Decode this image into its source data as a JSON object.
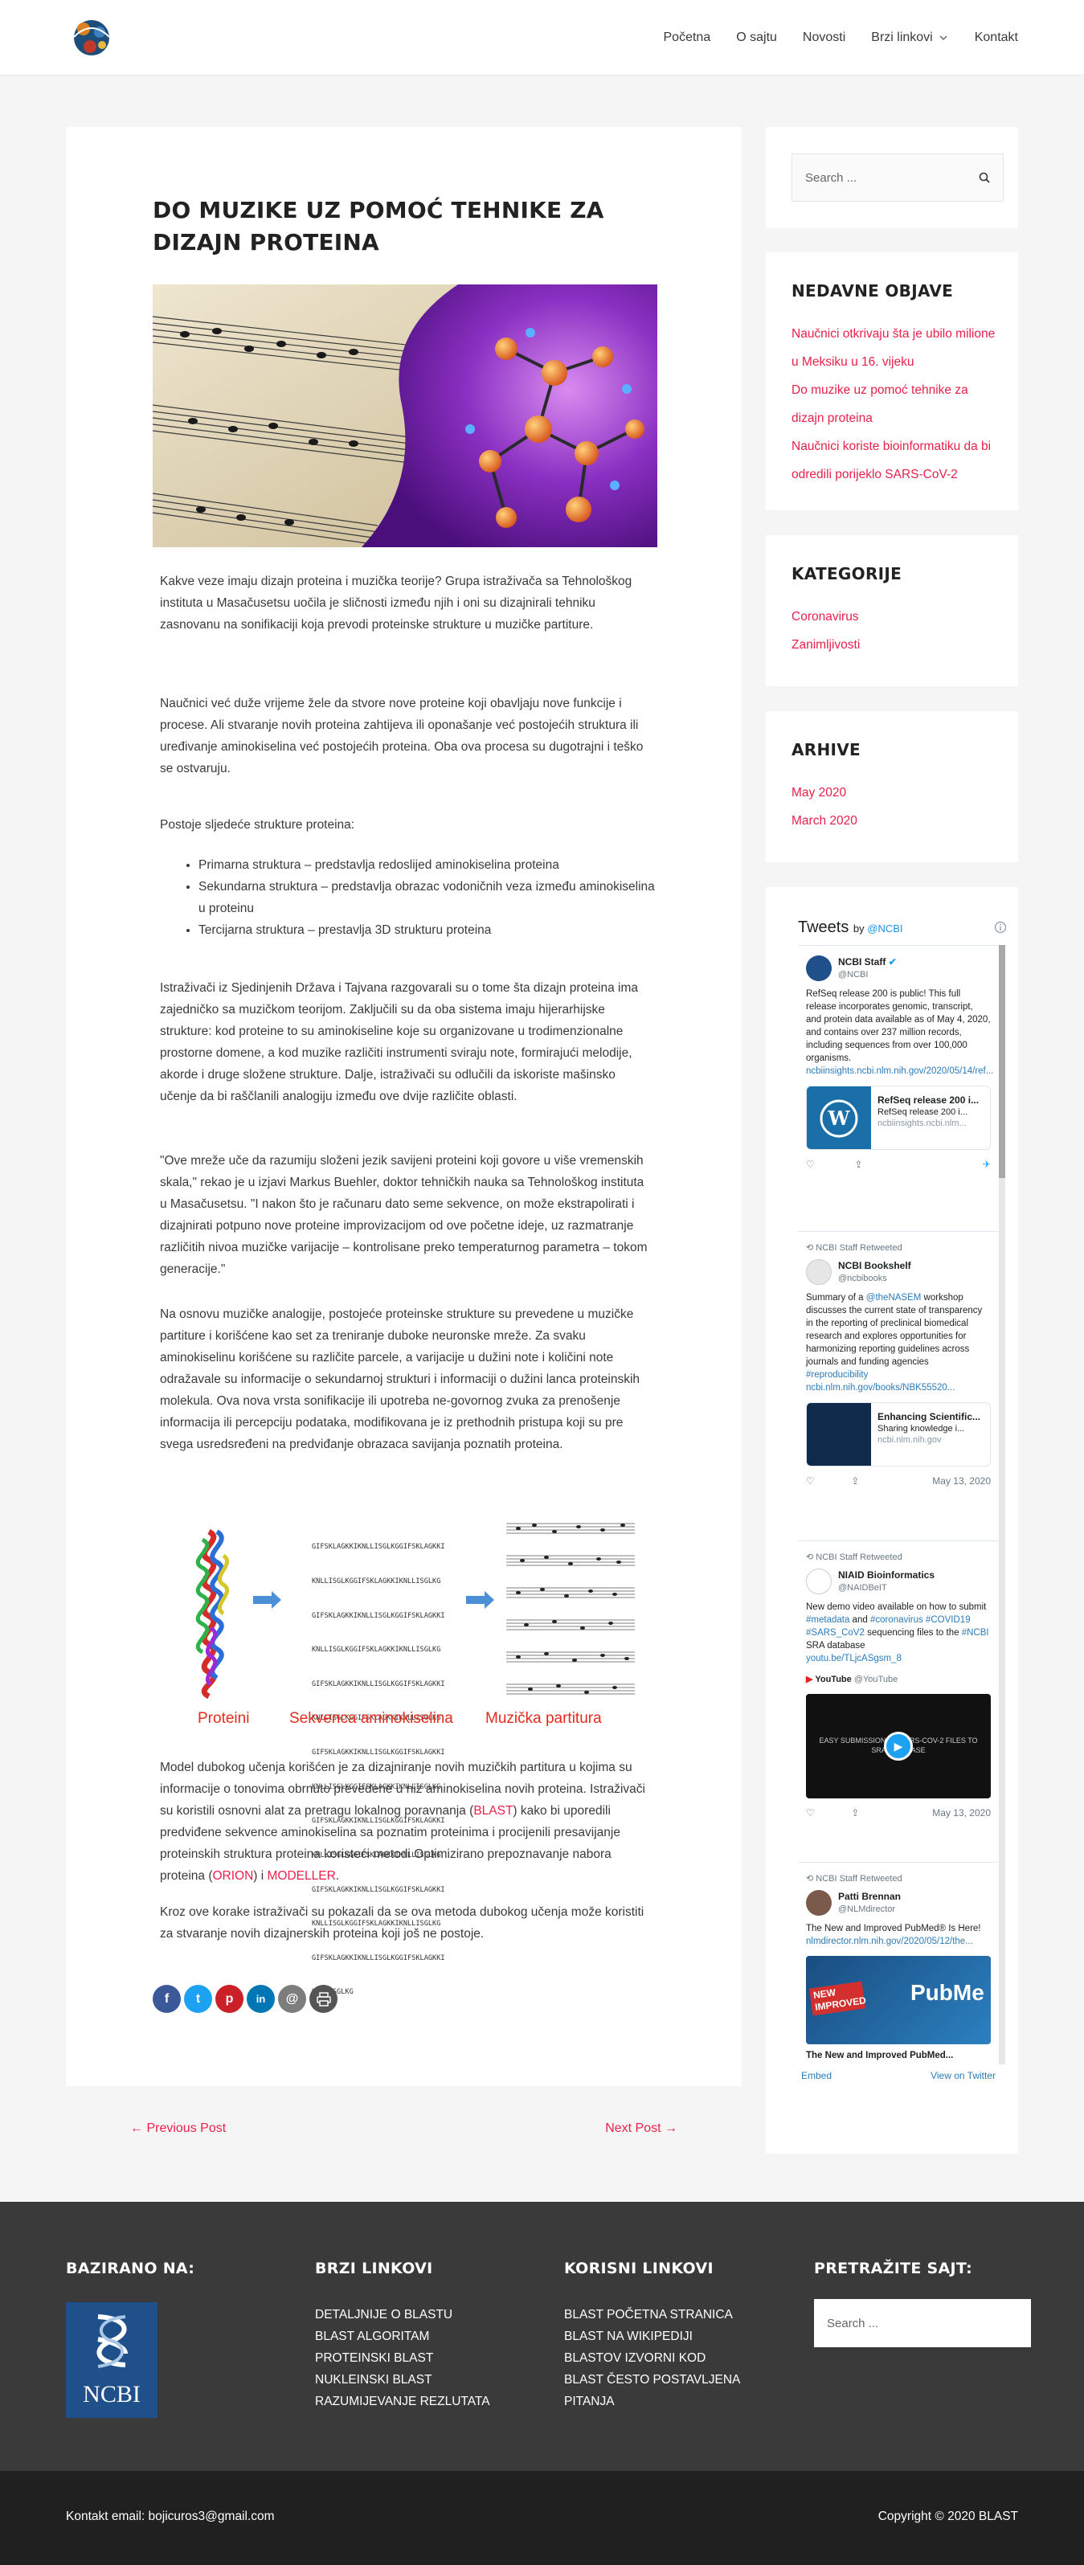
{
  "nav": {
    "items": [
      "Početna",
      "O sajtu",
      "Novosti",
      "Brzi linkovi",
      "Kontakt"
    ]
  },
  "article": {
    "title": "DO MUZIKE UZ POMOĆ TEHNIKE ZA DIZAJN PROTEINA",
    "p1": "Kakve veze imaju dizajn proteina i muzička teorije? Grupa istraživača sa Tehnološkog instituta u Masačusetsu uočila je sličnosti između njih i oni su dizajnirali tehniku zasnovanu na sonifikaciji koja prevodi proteinske strukture u muzičke partiture.",
    "p2": "Naučnici već duže vrijeme žele da stvore nove proteine koji obavljaju nove funkcije i procese. Ali stvaranje novih proteina zahtijeva ili oponašanje već postojećih struktura ili uređivanje aminokiselina već postojećih proteina. Oba ova procesa su dugotrajni i teško se ostvaruju.",
    "p3": "Postoje sljedeće strukture proteina:",
    "bullets": [
      "Primarna struktura – predstavlja redoslijed aminokiselina proteina",
      "Sekundarna struktura – predstavlja obrazac vodoničnih veza između aminokiselina u proteinu",
      "Tercijarna struktura – prestavlja 3D strukturu proteina"
    ],
    "p4": "Istraživači iz Sjedinjenih Država i Tajvana razgovarali su o tome šta dizajn proteina ima zajedničko sa muzičkom teorijom. Zaključili su da oba sistema imaju hijerarhijske strukture: kod proteine to su aminokiseline koje su organizovane u trodimenzionalne prostorne domene, a kod muzike različiti instrumenti sviraju note, formirajući melodije, akorde i druge složene strukture. Dalje, istraživači su odlučili da iskoriste mašinsko učenje da bi raščlanili analogiju  između ove dvije različite oblasti.",
    "p5": "\"Ove mreže uče da razumiju složeni jezik savijeni proteini koji govore u više vremenskih skala,\" rekao je u izjavi Markus Buehler, doktor tehničkih nauka sa Tehnološkog instituta u Masačusetsu. \"I nakon što je računaru dato seme sekvence, on može ekstrapolirati i dizajnirati potpuno nove proteine improvizacijom od ove početne ideje, uz razmatranje različitih nivoa muzičke varijacije – kontrolisane preko temperaturnog parametra – tokom generacije.\"",
    "p6": "Na osnovu muzičke analogije, postojeće proteinske strukture su prevedene u muzičke partiture i korišćene kao set za treniranje duboke neuronske mreže. Za svaku aminokiselinu korišćene su različite parcele, a varijacije u dužini note i količini note odražavale su informacije o sekundarnoj strukturi i informaciji o dužini lanca proteinskih molekula. Ova nova vrsta sonifikacije ili upotreba ne-govornog zvuka za prenošenje informacija ili percepciju podataka, modifikovana je iz prethodnih pristupa koji su pre svega usredsređeni na predviđanje obrazaca savijanja poznatih proteina.",
    "fig": {
      "label1": "Proteini",
      "label2": "Sekvenca aminokiselina",
      "label3": "Muzička partitura",
      "seq": [
        "GIFSKLAGKKIKNLLISGLKGGIFSKLAGKKI",
        "KNLLISGLKGGIFSKLAGKKIKNLLISGLKG",
        "GIFSKLAGKKIKNLLISGLKGGIFSKLAGKKI",
        "KNLLISGLKGGIFSKLAGKKIKNLLISGLKG",
        "GIFSKLAGKKIKNLLISGLKGGIFSKLAGKKI",
        "KNLLISGLKGGIFSKLAGKKIKNLLISGLKG",
        "GIFSKLAGKKIKNLLISGLKGGIFSKLAGKKI",
        "KNLLISGLKGGIFSKLAGKKIKNLLISGLKG",
        "GIFSKLAGKKIKNLLISGLKGGIFSKLAGKKI",
        "KNLLISGLKGGIFSKLAGKKIKNLLISGLKG",
        "GIFSKLAGKKIKNLLISGLKGGIFSKLAGKKI",
        "KNLLISGLKGGIFSKLAGKKIKNLLISGLKG",
        "GIFSKLAGKKIKNLLISGLKGGIFSKLAGKKI",
        "KNLLISGLKG"
      ]
    },
    "p7_a": "Model dubokog učenja korišćen je za dizajniranje novih muzičkih partitura u kojima su informacije o tonovima obrnuto prevedene u niz aminokiselina novih proteina. Istraživači su koristili osnovni alat za pretragu lokalnog poravnanja (",
    "p7_blast": "BLAST",
    "p7_b": ") kako bi uporedili predviđene sekvence aminokiselina sa poznatim proteinima i procijenili presavijanje proteinskih struktura proteina koristeći metodi Optimizirano prepoznavanje nabora proteina (",
    "p7_orion": "ORION",
    "p7_c": ") i ",
    "p7_modeller": "MODELLER",
    "p7_d": ".",
    "p8": "Kroz ove korake istraživači su pokazali da se ova metoda dubokog učenja može koristiti za stvaranje novih dizajnerskih proteina koji još ne postoje."
  },
  "share": [
    "f",
    "t",
    "p",
    "in",
    "@",
    "print"
  ],
  "postnav": {
    "prev": "← Previous Post",
    "next": "Next Post →"
  },
  "sidebar": {
    "search_placeholder": "Search ...",
    "recent_title": "NEDAVNE OBJAVE",
    "recent": [
      "Naučnici otkrivaju šta je ubilo milione u Meksiku u 16. vijeku",
      "Do muzike uz pomoć tehnike za dizajn proteina",
      "Naučnici koriste bioinformatiku da bi odredili porijeklo SARS-CoV-2"
    ],
    "categories_title": "KATEGORIJE",
    "categories": [
      "Coronavirus",
      "Zanimljivosti"
    ],
    "archives_title": "ARHIVE",
    "archives": [
      "May 2020",
      "March 2020"
    ]
  },
  "twitter": {
    "title": "Tweets",
    "by": "by",
    "handle": "@NCBI",
    "t1": {
      "name": "NCBI Staff",
      "handle": "@NCBI",
      "text": "RefSeq release 200 is public! This full release incorporates genomic, transcript, and protein data available as of May 4, 2020, and contains over 237 million records, including sequences from over 100,000 organisms.",
      "link": "ncbiinsights.ncbi.nlm.nih.gov/2020/05/14/ref...",
      "card_title": "RefSeq release 200 i...",
      "card_text": "RefSeq release 200 i...",
      "card_url": "ncbiinsights.ncbi.nlm..."
    },
    "t2": {
      "rt": "NCBI Staff Retweeted",
      "name": "NCBI Bookshelf",
      "handle": "@ncbibooks",
      "text_a": "Summary of a ",
      "mention": "@theNASEM",
      "text_b": " workshop discusses the current state of transparency in the reporting of preclinical biomedical research and explores opportunities for harmonizing reporting guidelines across journals and funding agencies ",
      "tag": "#reproducibility",
      "link": "ncbi.nlm.nih.gov/books/NBK55520...",
      "card_title": "Enhancing Scientific...",
      "card_text": "Sharing knowledge i...",
      "card_url": "ncbi.nlm.nih.gov",
      "date": "May 13, 2020"
    },
    "t3": {
      "rt": "NCBI Staff Retweeted",
      "name": "NIAID Bioinformatics",
      "handle": "@NAIDBeIT",
      "text_a": "New demo video available on how to submit ",
      "tag1": "#metadata",
      "text_b": " and ",
      "tag2": "#coronavirus",
      "tag3": "#COVID19",
      "tag4": "#SARS_CoV2",
      "text_c": " sequencing files to the ",
      "tag5": "#NCBI",
      "text_d": " SRA database",
      "link": "youtu.be/TLjcASgsm_8",
      "yt": "YouTube",
      "yt_handle": "@YouTube",
      "video_text": "EASY SUBMISSION OF SARS-COV-2 FILES TO SRA DATABASE",
      "date": "May 13, 2020"
    },
    "t4": {
      "rt": "NCBI Staff Retweeted",
      "name": "Patti Brennan",
      "handle": "@NLMdirector",
      "text": "The New and Improved PubMed® Is Here!",
      "link": "nlmdirector.nlm.nih.gov/2020/05/12/the...",
      "badge": "NEW IMPROVED",
      "img_text": "PubMe",
      "cut": "The New and Improved PubMed..."
    },
    "embed": "Embed",
    "view": "View on Twitter"
  },
  "footer": {
    "col1_title": "BAZIRANO NA:",
    "ncbi": "NCBI",
    "col2_title": "BRZI LINKOVI",
    "col2": [
      "Detaljnije o BLASTu",
      "BLAST algoritam",
      "Proteinski BLAST",
      "Nukleinski BLAST",
      "Razumijevanje rezlutata"
    ],
    "col3_title": "KORISNI LINKOVI",
    "col3": [
      "BLAST početna stranica",
      "BLAST na Wikipediji",
      "BLASTov izvorni kod",
      "BLAST često postavljena pitanja"
    ],
    "col4_title": "PRETRAŽITE SAJT:",
    "search_placeholder": "Search ...",
    "contact": "Kontakt email: bojicuros3@gmail.com",
    "copyright": "Copyright © 2020 BLAST"
  }
}
